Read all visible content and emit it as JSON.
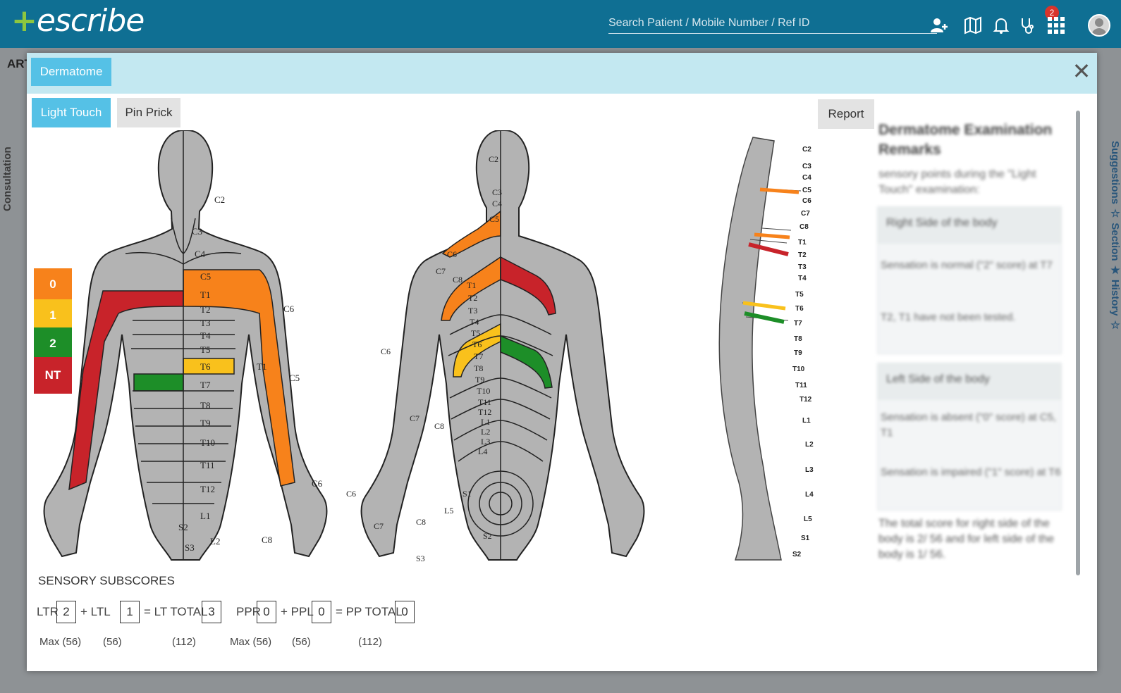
{
  "app": {
    "logo_text": "escribe",
    "search_placeholder": "Search Patient / Mobile Number / Ref ID",
    "notification_count": "2",
    "bg_tab": "ART",
    "bg_left_vertical": "Consultation",
    "bg_right_vertical": "Suggestions ☆ Section ★ History ☆"
  },
  "modal": {
    "tab": "Dermatome",
    "close": "✕",
    "buttons": {
      "light_touch": "Light Touch",
      "pin_prick": "Pin Prick",
      "report": "Report"
    },
    "legend": [
      {
        "label": "0",
        "color": "#f7821b"
      },
      {
        "label": "1",
        "color": "#f9c11c"
      },
      {
        "label": "2",
        "color": "#1d8e28"
      },
      {
        "label": "NT",
        "color": "#c8232a"
      }
    ],
    "front_labels": [
      "C2",
      "C3",
      "C4",
      "C5",
      "T1",
      "T2",
      "T3",
      "T4",
      "T5",
      "T6",
      "T7",
      "T8",
      "T9",
      "T10",
      "T11",
      "T12",
      "L1",
      "L2",
      "S2",
      "S3",
      "C6",
      "T1",
      "C5",
      "C6",
      "C8"
    ],
    "back_labels": [
      "C2",
      "C3",
      "C4",
      "C5",
      "C6",
      "C7",
      "C8",
      "T1",
      "T2",
      "T3",
      "T4",
      "T5",
      "T6",
      "T7",
      "T8",
      "T9",
      "T10",
      "T11",
      "T12",
      "L1",
      "L2",
      "L3",
      "L4",
      "L5",
      "S1",
      "S2",
      "S3",
      "C6",
      "C7",
      "C8",
      "C6",
      "C7",
      "C8"
    ],
    "spine_labels": [
      "C2",
      "C3",
      "C4",
      "C5",
      "C6",
      "C7",
      "C8",
      "T1",
      "T2",
      "T3",
      "T4",
      "T5",
      "T6",
      "T7",
      "T8",
      "T9",
      "T10",
      "T11",
      "T12",
      "L1",
      "L2",
      "L3",
      "L4",
      "L5",
      "S1",
      "S2"
    ],
    "scores": {
      "title": "SENSORY SUBSCORES",
      "ltr_label": "LTR",
      "ltr": "2",
      "ltl_label": "+ LTL",
      "ltl": "1",
      "lt_total_label": "= LT TOTAL",
      "lt_total": "3",
      "ppr_label": "PPR",
      "ppr": "0",
      "ppl_label": "+ PPL",
      "ppl": "0",
      "pp_total_label": "= PP TOTAL",
      "pp_total": "0",
      "max_ltr": "Max (56)",
      "max_ltl": "(56)",
      "max_lt": "(112)",
      "max_ppr": "Max (56)",
      "max_ppl": "(56)",
      "max_pp": "(112)"
    },
    "remarks": {
      "title": "Dermatome Examination Remarks",
      "subtitle": "sensory points during the \"Light Touch\" examination:",
      "right_head": "Right Side of the body",
      "right_items": [
        "Sensation is normal (\"2\" score) at T7",
        "T2, T1 have not been tested."
      ],
      "left_head": "Left Side of the body",
      "left_items": [
        "Sensation is absent (\"0\" score) at C5, T1",
        "Sensation is impaired (\"1\" score) at T6"
      ],
      "footer": "The total score for right side of the body is 2/ 56 and for left side of the body is 1/ 56."
    }
  }
}
